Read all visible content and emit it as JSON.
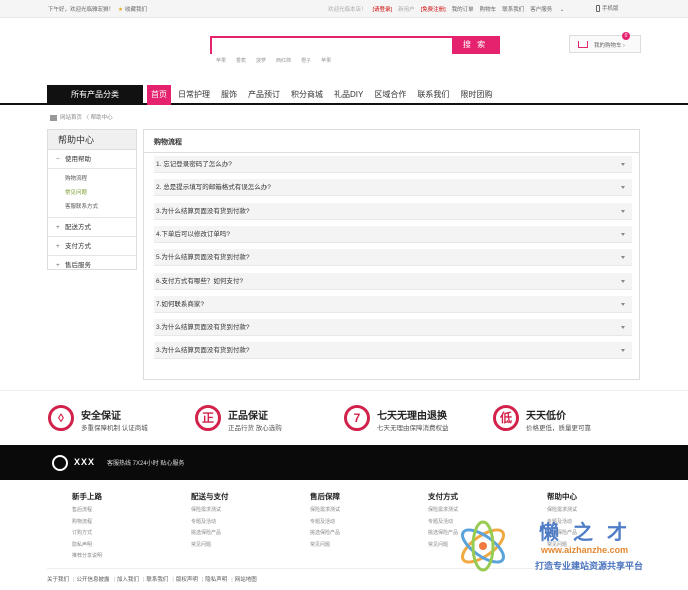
{
  "topbar": {
    "greeting": "下午好，欢迎光临雅宏狮！",
    "favorite": "收藏我们",
    "welcome": "欢迎光临本店！",
    "login": "[请登录]",
    "new_user": "新用户",
    "register": "[免费注册]",
    "my_orders": "我的订单",
    "cart": "购物车",
    "contact": "联系我们",
    "service": "客户服务",
    "mobile": "手机版"
  },
  "search": {
    "placeholder": "",
    "button": "搜 索",
    "hot": [
      "苹果",
      "香蕉",
      "菠萝",
      "西红柿",
      "橙子",
      "苹果"
    ]
  },
  "cart": {
    "label": "我的购物车",
    "count": "0"
  },
  "nav": {
    "category": "所有产品分类",
    "items": [
      "首页",
      "日常护理",
      "服饰",
      "产品预订",
      "积分商城",
      "礼品DIY",
      "区域合作",
      "联系我们",
      "限时团购"
    ]
  },
  "breadcrumb": {
    "home": "网站首页",
    "sep": "〈",
    "current": "帮助中心"
  },
  "sidebar": {
    "title": "帮助中心",
    "groups": [
      {
        "mark": "−",
        "label": "使用帮助"
      },
      {
        "mark": "+",
        "label": "配送方式"
      },
      {
        "mark": "+",
        "label": "支付方式"
      },
      {
        "mark": "+",
        "label": "售后服务"
      }
    ],
    "subs": [
      "购物流程",
      "常见问题",
      "客服联系方式"
    ]
  },
  "main": {
    "title": "购物流程",
    "questions": [
      "1. 忘记登录密码了怎么办?",
      "2. 总是提示填写的邮箱格式有误怎么办?",
      "3.为什么结算页面没有货到付款?",
      "4.下单后可以修改订单吗?",
      "5.为什么结算页面没有货到付款?",
      "6.支付方式有哪些？如何支付?",
      "7.如何联系商家?",
      "3.为什么结算页面没有货到付款?",
      "3.为什么结算页面没有货到付款?"
    ]
  },
  "guarantees": [
    {
      "icon": "shield-icon",
      "glyph": "◊",
      "title": "安全保证",
      "desc": "多重保障机制 认证商城"
    },
    {
      "icon": "genuine-icon",
      "glyph": "正",
      "title": "正品保证",
      "desc": "正品行货 放心选购"
    },
    {
      "icon": "seven-day-icon",
      "glyph": "7",
      "title": "七天无理由退换",
      "desc": "七天无理由保障消费权益"
    },
    {
      "icon": "low-price-icon",
      "glyph": "低",
      "title": "天天低价",
      "desc": "价格更低，质量更可靠"
    }
  ],
  "hotline": {
    "brand": "XXX",
    "text": "客服热线 7X24小时 贴心服务"
  },
  "footer": {
    "columns": [
      {
        "title": "新手上路",
        "items": [
          "售后流程",
          "购物流程",
          "订购方式",
          "隐私声明",
          "推荐分享说明"
        ]
      },
      {
        "title": "配送与支付",
        "items": [
          "保险需求测试",
          "专题及活动",
          "挑选保险产品",
          "常见问题"
        ]
      },
      {
        "title": "售后保障",
        "items": [
          "保险需求测试",
          "专题及活动",
          "挑选保险产品",
          "常见问题"
        ]
      },
      {
        "title": "支付方式",
        "items": [
          "保险需求测试",
          "专题及活动",
          "挑选保险产品",
          "常见问题"
        ]
      },
      {
        "title": "帮助中心",
        "items": [
          "保险需求测试",
          "专题及活动",
          "挑选保险产品",
          "常见问题"
        ]
      }
    ],
    "links": [
      "关于我们",
      "公开信息披露",
      "加入我们",
      "联系我们",
      "版权声明",
      "隐私声明",
      "网站地图"
    ]
  },
  "watermark": {
    "brand": "懒之才",
    "url": "www.aizhanzhe.com",
    "slogan": "打造专业建站资源共享平台"
  },
  "colors": {
    "accent": "#e5226e",
    "guarantee": "#d2214a"
  }
}
